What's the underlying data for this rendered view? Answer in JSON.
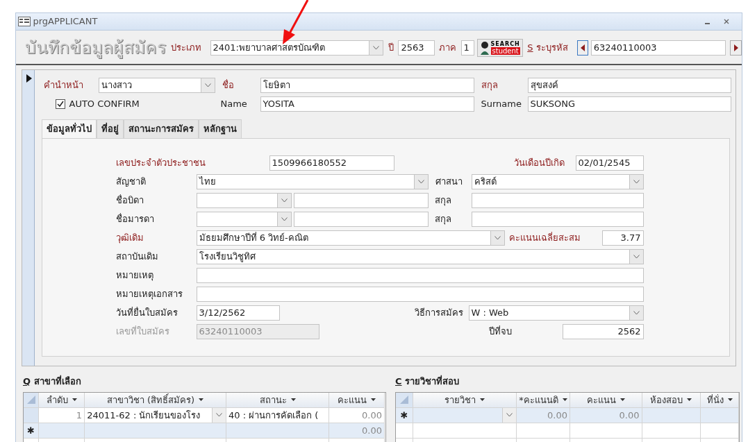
{
  "window": {
    "title": "prgAPPLICANT"
  },
  "annotations": [
    {
      "kind": "arrow"
    }
  ],
  "header": {
    "heading": "บันทึกข้อมูลผู้สมัคร",
    "type_label": "ประเภท",
    "type_value": "2401:พยาบาลศาสตรบัณฑิต",
    "year_label": "ปี",
    "year_value": "2563",
    "term_label": "ภาค",
    "term_value": "1",
    "search_button": {
      "line1": "SEARCH",
      "line2": "student"
    },
    "code_hotkey": "S",
    "code_label": "ระบุรหัส",
    "code_value": "63240110003"
  },
  "record": {
    "title_label": "คำนำหน้า",
    "title_value": "นางสาว",
    "first_name_label": "ชื่อ",
    "first_name_value": "โยษิตา",
    "last_name_label": "สกุล",
    "last_name_value": "สุขสงค์",
    "auto_confirm": {
      "label": "AUTO CONFIRM",
      "checked": true
    },
    "name_en_label": "Name",
    "name_en_value": "YOSITA",
    "surname_en_label": "Surname",
    "surname_en_value": "SUKSONG"
  },
  "tabs": [
    {
      "label": "ข้อมูลทั่วไป",
      "selected": true
    },
    {
      "label": "ที่อยู่",
      "selected": false
    },
    {
      "label": "สถานะการสมัคร",
      "selected": false
    },
    {
      "label": "หลักฐาน",
      "selected": false
    }
  ],
  "form_rows": [
    {
      "fields": [
        {
          "kind": "label",
          "text": "เลขประจำตัวประชาชน",
          "required": true,
          "disabled": false
        },
        {
          "kind": "text",
          "value": "1509966180552",
          "disabled": false
        },
        {
          "kind": "label",
          "text": "วันเดือนปีเกิด",
          "required": true,
          "disabled": false
        },
        {
          "kind": "text",
          "value": "02/01/2545",
          "disabled": false
        }
      ]
    },
    {
      "fields": [
        {
          "kind": "label",
          "text": "สัญชาติ",
          "required": false,
          "disabled": false
        },
        {
          "kind": "combo",
          "value": "ไทย",
          "disabled": false
        },
        {
          "kind": "label",
          "text": "ศาสนา",
          "required": false,
          "disabled": false
        },
        {
          "kind": "combo",
          "value": "คริสต์",
          "disabled": false
        }
      ]
    },
    {
      "fields": [
        {
          "kind": "label",
          "text": "ชื่อบิดา",
          "required": false,
          "disabled": false
        },
        {
          "kind": "combo",
          "disabled": false
        },
        {
          "kind": "text",
          "disabled": false
        },
        {
          "kind": "label",
          "text": "สกุล",
          "required": false,
          "disabled": false
        },
        {
          "kind": "text",
          "disabled": false
        }
      ]
    },
    {
      "fields": [
        {
          "kind": "label",
          "text": "ชื่อมารดา",
          "required": false,
          "disabled": false
        },
        {
          "kind": "combo",
          "disabled": false
        },
        {
          "kind": "text",
          "disabled": false
        },
        {
          "kind": "label",
          "text": "สกุล",
          "required": false,
          "disabled": false
        },
        {
          "kind": "text",
          "disabled": false
        }
      ]
    },
    {
      "fields": [
        {
          "kind": "label",
          "text": "วุฒิเดิม",
          "required": true,
          "disabled": false
        },
        {
          "kind": "combo",
          "value": "มัธยมศึกษาปีที่ 6 วิทย์-คณิต",
          "disabled": false
        },
        {
          "kind": "label",
          "text": "คะแนนเฉลี่ยสะสม",
          "required": true,
          "disabled": false
        },
        {
          "kind": "number",
          "value": "3.77",
          "disabled": false
        }
      ]
    },
    {
      "fields": [
        {
          "kind": "label",
          "text": "สถาบันเดิม",
          "required": false,
          "disabled": false
        },
        {
          "kind": "combo",
          "value": "โรงเรียนวิชูทิศ",
          "disabled": false
        }
      ]
    },
    {
      "fields": [
        {
          "kind": "label",
          "text": "หมายเหตุ",
          "required": false,
          "disabled": false
        },
        {
          "kind": "text",
          "disabled": false
        }
      ]
    },
    {
      "fields": [
        {
          "kind": "label",
          "text": "หมายเหตุเอกสาร",
          "required": false,
          "disabled": false
        },
        {
          "kind": "text",
          "disabled": false
        }
      ]
    },
    {
      "fields": [
        {
          "kind": "label",
          "text": "วันที่ยื่นใบสมัคร",
          "required": false,
          "disabled": false
        },
        {
          "kind": "text",
          "value": "3/12/2562",
          "disabled": false
        },
        {
          "kind": "label",
          "text": "วิธีการสมัคร",
          "required": false,
          "disabled": false
        },
        {
          "kind": "combo",
          "value": "W : Web",
          "disabled": false
        }
      ]
    },
    {
      "fields": [
        {
          "kind": "label",
          "text": "เลขที่ใบสมัคร",
          "required": false,
          "disabled": true
        },
        {
          "kind": "text",
          "value": "63240110003",
          "disabled": true
        },
        {
          "kind": "label",
          "text": "ปีที่จบ",
          "required": false,
          "disabled": false
        },
        {
          "kind": "number",
          "value": "2562",
          "disabled": false
        }
      ]
    }
  ],
  "choices": {
    "hotkey": "Q",
    "title": "สาขาที่เลือก",
    "columns": [
      "ลำดับ",
      "สาขาวิชา (สิทธิ์สมัคร)",
      "สถานะ",
      "คะแนน"
    ],
    "rows": [
      {
        "kind": "data",
        "cells": [
          "1",
          "24011-62 : นักเรียนของโรง",
          "40 : ผ่านการคัดเลือก (",
          "0.00"
        ]
      },
      {
        "kind": "new",
        "marker": "✱",
        "cells": [
          "",
          "",
          "",
          "0.00"
        ]
      }
    ]
  },
  "exams": {
    "hotkey": "C",
    "title": "รายวิชาที่สอบ",
    "columns": [
      "รายวิชา",
      "*คะแนนดิ",
      "คะแนน",
      "ห้องสอบ",
      "ที่นั่ง"
    ],
    "rows": [
      {
        "kind": "new",
        "marker": "✱",
        "cells": [
          "",
          "0.00",
          "0.00",
          "",
          ""
        ]
      }
    ]
  }
}
